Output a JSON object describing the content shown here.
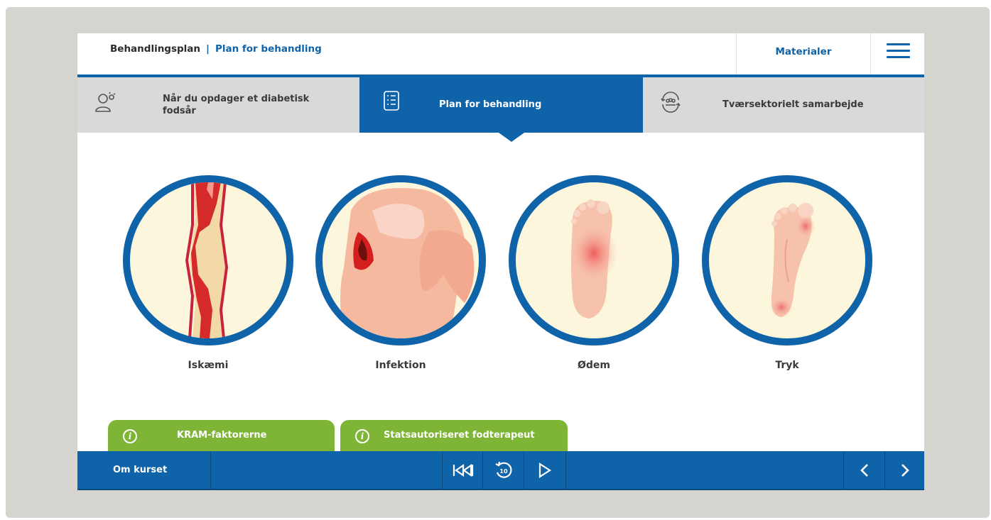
{
  "header": {
    "breadcrumb_root": "Behandlingsplan",
    "breadcrumb_separator": "|",
    "breadcrumb_current": "Plan for behandling",
    "materials_label": "Materialer"
  },
  "tabs": [
    {
      "label": "Når du opdager et diabetisk fodsår",
      "icon": "person-search-icon",
      "active": false
    },
    {
      "label": "Plan for behandling",
      "icon": "checklist-icon",
      "active": true
    },
    {
      "label": "Tværsektorielt samarbejde",
      "icon": "group-cycle-icon",
      "active": false
    }
  ],
  "topics": [
    {
      "label": "Iskæmi",
      "image": "artery-illustration"
    },
    {
      "label": "Infektion",
      "image": "infected-toe-illustration"
    },
    {
      "label": "Ødem",
      "image": "swollen-foot-illustration"
    },
    {
      "label": "Tryk",
      "image": "pressure-foot-illustration"
    }
  ],
  "info_tabs": [
    {
      "label": "KRAM-faktorerne",
      "icon": "info-icon"
    },
    {
      "label": "Statsautoriseret fodterapeut",
      "icon": "info-icon"
    }
  ],
  "footer": {
    "about_label": "Om kurset",
    "controls": [
      "skip-to-start-icon",
      "replay-10-icon",
      "play-icon",
      "previous-icon",
      "next-icon"
    ],
    "replay_seconds": "10"
  },
  "colors": {
    "brand_blue": "#0f63a9",
    "green": "#7eb536",
    "tab_gray": "#d9d9d9",
    "circle_fill": "#fbf6dc"
  }
}
